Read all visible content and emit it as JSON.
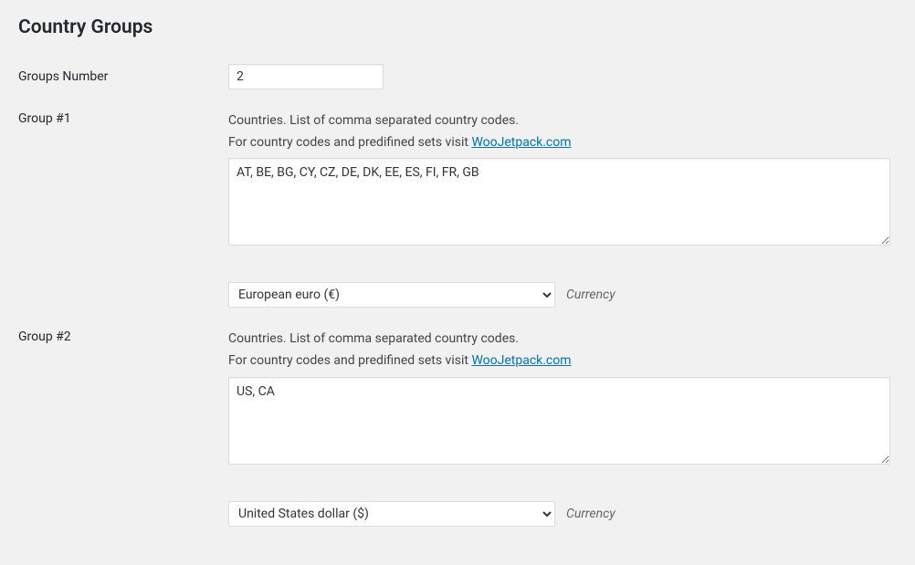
{
  "heading": "Country Groups",
  "groupsNumber": {
    "label": "Groups Number",
    "value": "2"
  },
  "groupDescription": {
    "line1": "Countries. List of comma separated country codes.",
    "line2_prefix": "For country codes and predifined sets visit ",
    "link_text": "WooJetpack.com"
  },
  "currencyLabel": "Currency",
  "groups": [
    {
      "label": "Group #1",
      "countries": "AT, BE, BG, CY, CZ, DE, DK, EE, ES, FI, FR, GB",
      "currency": "European euro (€)"
    },
    {
      "label": "Group #2",
      "countries": "US, CA",
      "currency": "United States dollar ($)"
    }
  ]
}
